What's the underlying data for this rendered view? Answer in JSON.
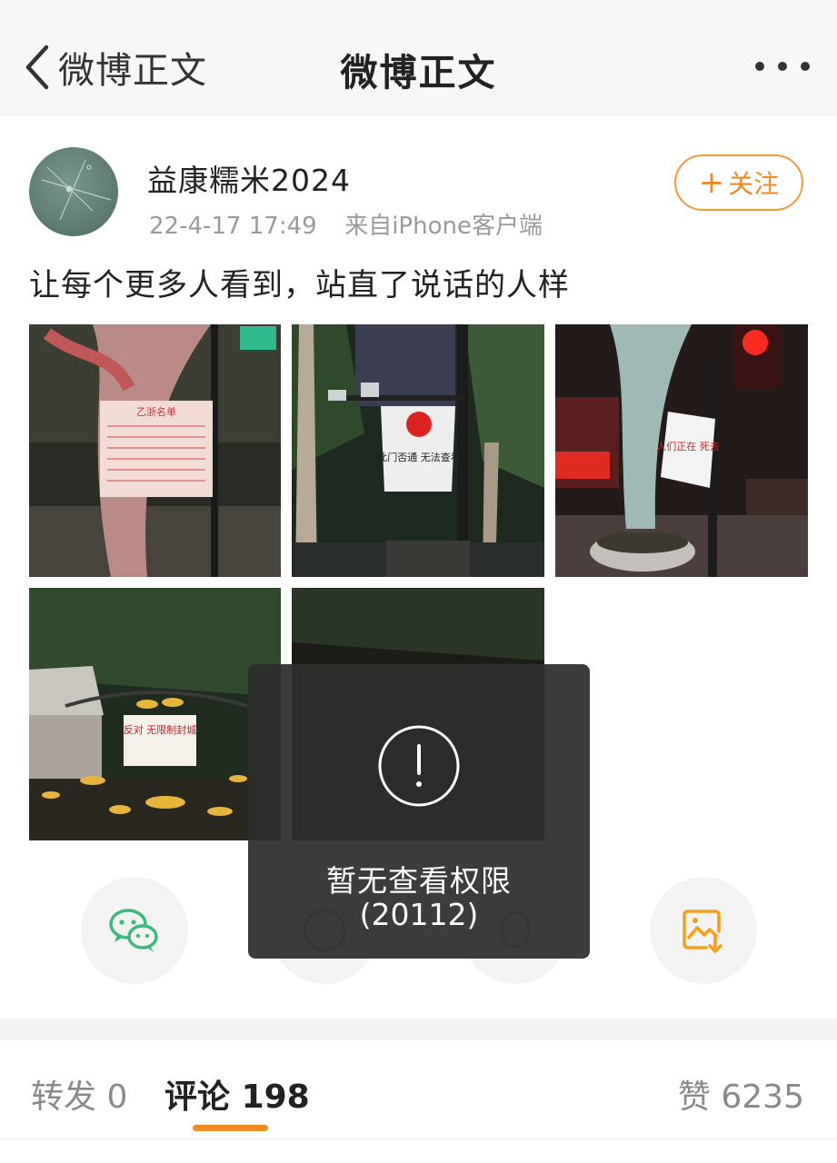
{
  "nav": {
    "back_label": "微博正文",
    "title": "微博正文"
  },
  "post": {
    "author": "益康糯米2024",
    "timestamp": "22-4-17 17:49",
    "source": "来自iPhone客户端",
    "follow_label": "关注",
    "text": "让每个更多人看到，站直了说话的人样"
  },
  "photos": [
    {
      "sign_text": "乙浙名单"
    },
    {
      "sign_text": "此门否通 无法查看"
    },
    {
      "sign_text": "人们正在 死去"
    },
    {
      "sign_text": "反对 无限制封城"
    },
    {
      "sign_text": ""
    }
  ],
  "share": [
    {
      "icon": "wechat-icon"
    },
    {
      "icon": "moments-icon"
    },
    {
      "icon": "qq-icon"
    },
    {
      "icon": "save-image-icon"
    }
  ],
  "toast": {
    "message": "暂无查看权限",
    "code": "(20112)"
  },
  "tabs": {
    "repost_label": "转发",
    "repost_count": "0",
    "comment_label": "评论",
    "comment_count": "198",
    "like_label": "赞",
    "like_count": "6235"
  },
  "colors": {
    "accent": "#f08a24",
    "follow_border": "#f29a3c",
    "wechat_green": "#3dbb7a",
    "save_orange": "#f3a11d"
  }
}
